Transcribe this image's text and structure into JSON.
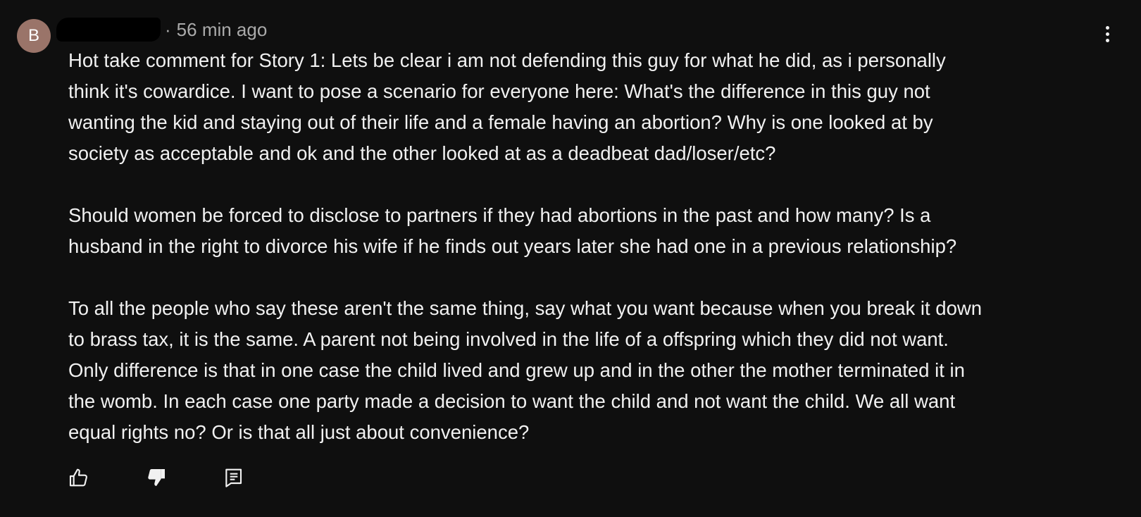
{
  "comment": {
    "avatar_letter": "B",
    "avatar_color": "#9a7469",
    "username_redacted": true,
    "separator": "·",
    "timestamp": "56 min ago",
    "paragraphs": [
      "Hot take comment for Story 1:  Lets be clear i am not defending this guy for what he did, as i personally\nthink it's cowardice.  I want to pose a scenario for everyone here:  What's the difference in this guy not\nwanting the kid and staying out of their life and a female having an abortion?  Why is one looked at by\nsociety as acceptable and ok and the other looked at as a deadbeat dad/loser/etc?",
      "Should women be forced to disclose to partners if they had abortions in the past and how many? Is a\nhusband in the right to divorce his wife if he finds out years later she had one in a previous relationship?",
      "To all the people who say these aren't the same thing, say what you want because when you break it down\nto brass tax, it is the same.  A parent not being involved in the life of a offspring which they did not want.\nOnly difference is that in one case the child lived and grew up and in the other the mother terminated it in\nthe womb.  In each case one party made a decision to want the child and not want the child.  We all want\nequal rights no?  Or is that all just about convenience?"
    ]
  },
  "actions": {
    "like_icon": "thumbs-up-outline",
    "dislike_icon": "thumbs-down-filled",
    "reply_icon": "reply-comment"
  },
  "menu_icon": "more-vertical",
  "colors": {
    "background": "#0f0f0f",
    "text": "#f1f1f1",
    "meta": "#aaaaaa"
  }
}
